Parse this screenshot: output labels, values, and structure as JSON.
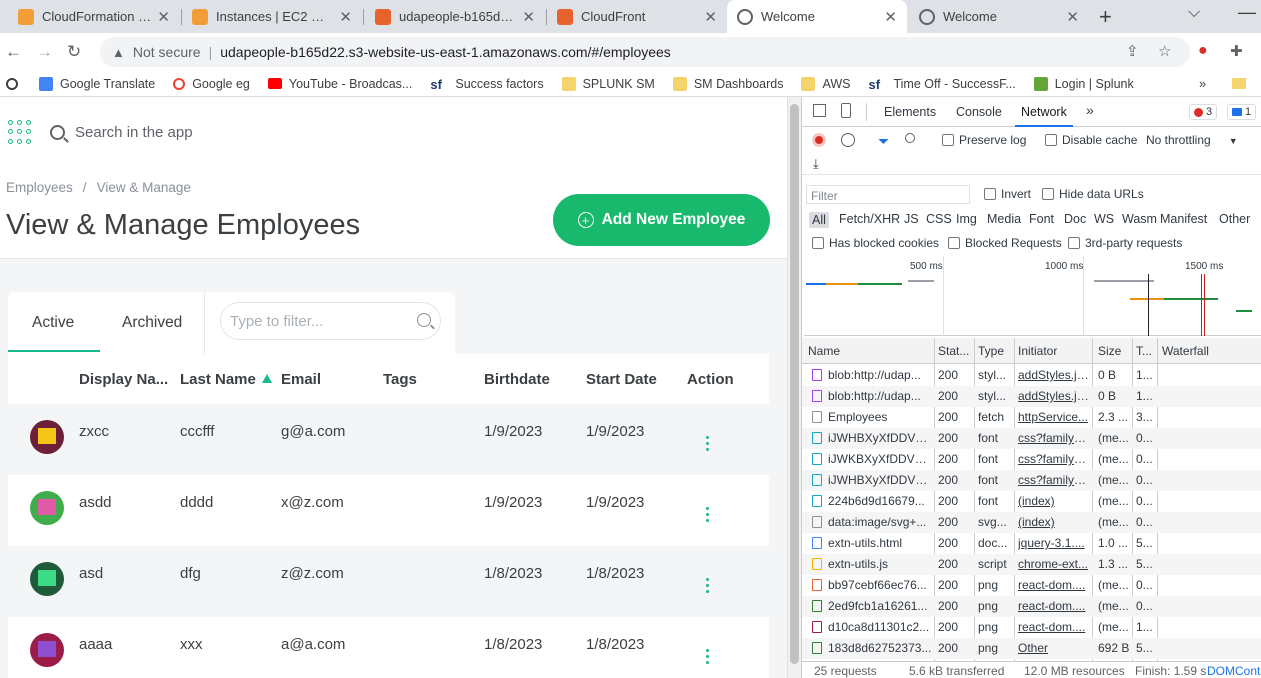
{
  "tabs": [
    {
      "title": "CloudFormation - Stac",
      "favicon_color": "#f29d38"
    },
    {
      "title": "Instances | EC2 Manag",
      "favicon_color": "#f29d38"
    },
    {
      "title": "udapeople-b165d22 -",
      "favicon_color": "#e8632b"
    },
    {
      "title": "CloudFront",
      "favicon_color": "#e8632b"
    },
    {
      "title": "Welcome",
      "favicon_color": "#5f6368"
    },
    {
      "title": "Welcome",
      "favicon_color": "#5f6368"
    }
  ],
  "address": {
    "security": "Not secure",
    "url": "udapeople-b165d22.s3-website-us-east-1.amazonaws.com/#/employees"
  },
  "bookmarks": [
    {
      "label": "Google Translate",
      "icon": "google-translate-icon"
    },
    {
      "label": "Google eg",
      "icon": "google-icon"
    },
    {
      "label": "YouTube - Broadcas...",
      "icon": "youtube-icon"
    },
    {
      "label": "Success factors",
      "icon": "sf-icon"
    },
    {
      "label": "SPLUNK SM",
      "icon": "folder-icon"
    },
    {
      "label": "SM Dashboards",
      "icon": "folder-icon"
    },
    {
      "label": "AWS",
      "icon": "folder-icon"
    },
    {
      "label": "Time Off - SuccessF...",
      "icon": "sf-icon"
    },
    {
      "label": "Login | Splunk",
      "icon": "splunk-icon"
    }
  ],
  "app": {
    "search_placeholder": "Search in the app",
    "breadcrumb": {
      "root": "Employees",
      "sep": "/",
      "current": "View & Manage"
    },
    "title": "View & Manage Employees",
    "add_button": "Add New Employee",
    "tab_active": "Active",
    "tab_archived": "Archived",
    "filter_placeholder": "Type to filter...",
    "columns": {
      "display_name": "Display Na...",
      "last_name": "Last Name",
      "email": "Email",
      "tags": "Tags",
      "birthdate": "Birthdate",
      "start_date": "Start Date",
      "action": "Action"
    },
    "employees": [
      {
        "display_name": "zxcc",
        "last_name": "cccfff",
        "email": "g@a.com",
        "tags": "",
        "birthdate": "1/9/2023",
        "start_date": "1/9/2023",
        "avatar_bg": "#6b1f3a",
        "avatar_fg": "#f5c518"
      },
      {
        "display_name": "asdd",
        "last_name": "dddd",
        "email": "x@z.com",
        "tags": "",
        "birthdate": "1/9/2023",
        "start_date": "1/9/2023",
        "avatar_bg": "#3fae4a",
        "avatar_fg": "#e05aa8"
      },
      {
        "display_name": "asd",
        "last_name": "dfg",
        "email": "z@z.com",
        "tags": "",
        "birthdate": "1/8/2023",
        "start_date": "1/8/2023",
        "avatar_bg": "#1f5b3a",
        "avatar_fg": "#3ddc84"
      },
      {
        "display_name": "aaaa",
        "last_name": "xxx",
        "email": "a@a.com",
        "tags": "",
        "birthdate": "1/8/2023",
        "start_date": "1/8/2023",
        "avatar_bg": "#9b1c48",
        "avatar_fg": "#8f4fd1"
      }
    ]
  },
  "devtools": {
    "tabs": {
      "elements": "Elements",
      "console": "Console",
      "network": "Network"
    },
    "error_count": "3",
    "message_count": "1",
    "preserve_log": "Preserve log",
    "disable_cache": "Disable cache",
    "throttling": "No throttling",
    "filter_placeholder": "Filter",
    "invert": "Invert",
    "hide_data_urls": "Hide data URLs",
    "type_filters": [
      "All",
      "Fetch/XHR",
      "JS",
      "CSS",
      "Img",
      "Media",
      "Font",
      "Doc",
      "WS",
      "Wasm",
      "Manifest",
      "Other"
    ],
    "has_blocked_cookies": "Has blocked cookies",
    "blocked_requests": "Blocked Requests",
    "third_party": "3rd-party requests",
    "timeline_labels": [
      "500 ms",
      "1000 ms",
      "1500 ms"
    ],
    "columns": {
      "name": "Name",
      "status": "Stat...",
      "type": "Type",
      "initiator": "Initiator",
      "size": "Size",
      "time": "T...",
      "waterfall": "Waterfall"
    },
    "requests": [
      {
        "name": "blob:http://udap...",
        "status": "200",
        "type": "styl...",
        "initiator": "addStyles.js...",
        "size": "0 B",
        "time": "1...",
        "icon_color": "#a142f4"
      },
      {
        "name": "blob:http://udap...",
        "status": "200",
        "type": "styl...",
        "initiator": "addStyles.js...",
        "size": "0 B",
        "time": "1...",
        "icon_color": "#a142f4"
      },
      {
        "name": "Employees",
        "status": "200",
        "type": "fetch",
        "initiator": "httpService...",
        "size": "2.3 ...",
        "time": "3...",
        "icon_color": "#8a9199"
      },
      {
        "name": "iJWHBXyXfDDVX...",
        "status": "200",
        "type": "font",
        "initiator": "css?family=...",
        "size": "(me...",
        "time": "0...",
        "icon_color": "#1aa3c9"
      },
      {
        "name": "iJWKBXyXfDDVX...",
        "status": "200",
        "type": "font",
        "initiator": "css?family=...",
        "size": "(me...",
        "time": "0...",
        "icon_color": "#1aa3c9"
      },
      {
        "name": "iJWHBXyXfDDVX...",
        "status": "200",
        "type": "font",
        "initiator": "css?family=...",
        "size": "(me...",
        "time": "0...",
        "icon_color": "#1aa3c9"
      },
      {
        "name": "224b6d9d16679...",
        "status": "200",
        "type": "font",
        "initiator": "(index)",
        "size": "(me...",
        "time": "0...",
        "icon_color": "#1aa3c9"
      },
      {
        "name": "data:image/svg+...",
        "status": "200",
        "type": "svg...",
        "initiator": "(index)",
        "size": "(me...",
        "time": "0...",
        "icon_color": "#8a9199"
      },
      {
        "name": "extn-utils.html",
        "status": "200",
        "type": "doc...",
        "initiator": "jquery-3.1....",
        "size": "1.0 ...",
        "time": "5...",
        "icon_color": "#4285f4"
      },
      {
        "name": "extn-utils.js",
        "status": "200",
        "type": "script",
        "initiator": "chrome-ext...",
        "size": "1.3 ...",
        "time": "5...",
        "icon_color": "#f4b400"
      },
      {
        "name": "bb97cebf66ec76...",
        "status": "200",
        "type": "png",
        "initiator": "react-dom....",
        "size": "(me...",
        "time": "0...",
        "icon_color": "#e8632b"
      },
      {
        "name": "2ed9fcb1a16261...",
        "status": "200",
        "type": "png",
        "initiator": "react-dom....",
        "size": "(me...",
        "time": "0...",
        "icon_color": "#2e7d32"
      },
      {
        "name": "d10ca8d11301c2...",
        "status": "200",
        "type": "png",
        "initiator": "react-dom....",
        "size": "(me...",
        "time": "1...",
        "icon_color": "#9b1c48"
      },
      {
        "name": "183d8d62752373...",
        "status": "200",
        "type": "png",
        "initiator": "Other",
        "size": "692 B",
        "time": "5...",
        "icon_color": "#2e7d32"
      }
    ],
    "status_bar": {
      "requests": "25 requests",
      "transferred": "5.6 kB transferred",
      "resources": "12.0 MB resources",
      "finish": "Finish: 1.59 s",
      "domcont": "DOMCont"
    }
  },
  "colors": {
    "accent": "#18b98a",
    "button": "#18b96c",
    "devtools_blue": "#1a73e8",
    "error": "#d93025"
  }
}
